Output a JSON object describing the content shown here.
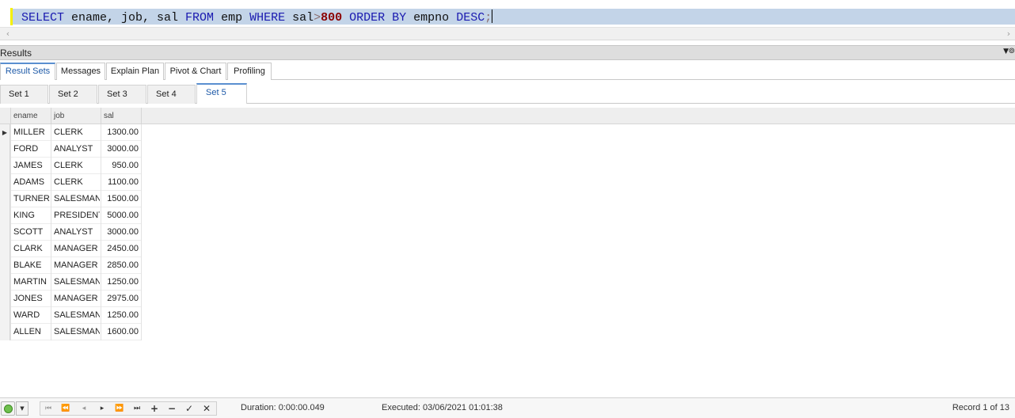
{
  "editor": {
    "tokens": [
      {
        "text": "SELECT",
        "cls": "kw"
      },
      {
        "text": " ename, job, sal ",
        "cls": ""
      },
      {
        "text": "FROM",
        "cls": "kw"
      },
      {
        "text": " emp ",
        "cls": ""
      },
      {
        "text": "WHERE",
        "cls": "kw"
      },
      {
        "text": " sal",
        "cls": ""
      },
      {
        "text": ">",
        "cls": "op"
      },
      {
        "text": "800",
        "cls": "num"
      },
      {
        "text": " ",
        "cls": ""
      },
      {
        "text": "ORDER BY",
        "cls": "kw"
      },
      {
        "text": " empno ",
        "cls": ""
      },
      {
        "text": "DESC",
        "cls": "kw"
      },
      {
        "text": ";",
        "cls": "op"
      }
    ]
  },
  "results_panel": {
    "title": "Results",
    "tabs": [
      "Result Sets",
      "Messages",
      "Explain Plan",
      "Pivot & Chart",
      "Profiling"
    ],
    "active_tab": "Result Sets",
    "sets": [
      "Set 1",
      "Set 2",
      "Set 3",
      "Set 4",
      "Set 5"
    ],
    "active_set": "Set 5"
  },
  "grid": {
    "columns": [
      "ename",
      "job",
      "sal"
    ],
    "rows": [
      [
        "MILLER",
        "CLERK",
        "1300.00"
      ],
      [
        "FORD",
        "ANALYST",
        "3000.00"
      ],
      [
        "JAMES",
        "CLERK",
        "950.00"
      ],
      [
        "ADAMS",
        "CLERK",
        "1100.00"
      ],
      [
        "TURNER",
        "SALESMAN",
        "1500.00"
      ],
      [
        "KING",
        "PRESIDENT",
        "5000.00"
      ],
      [
        "SCOTT",
        "ANALYST",
        "3000.00"
      ],
      [
        "CLARK",
        "MANAGER",
        "2450.00"
      ],
      [
        "BLAKE",
        "MANAGER",
        "2850.00"
      ],
      [
        "MARTIN",
        "SALESMAN",
        "1250.00"
      ],
      [
        "JONES",
        "MANAGER",
        "2975.00"
      ],
      [
        "WARD",
        "SALESMAN",
        "1250.00"
      ],
      [
        "ALLEN",
        "SALESMAN",
        "1600.00"
      ]
    ],
    "current_row": 1
  },
  "status": {
    "duration": "Duration: 0:00:00.049",
    "executed": "Executed: 03/06/2021 01:01:38",
    "record": "Record 1 of 13"
  },
  "colors": {
    "keyword": "#1a1ab0",
    "number": "#8b0000",
    "active_tab": "#1e5aa8",
    "line_highlight": "#c3d4e8",
    "status_ok": "#6fc04e"
  },
  "icons": {
    "nav": [
      "first-page-icon",
      "prev-page-icon",
      "prev-record-icon",
      "next-record-icon",
      "next-page-icon",
      "last-page-icon",
      "add-record-icon",
      "delete-record-icon",
      "post-edit-icon",
      "cancel-edit-icon"
    ]
  }
}
